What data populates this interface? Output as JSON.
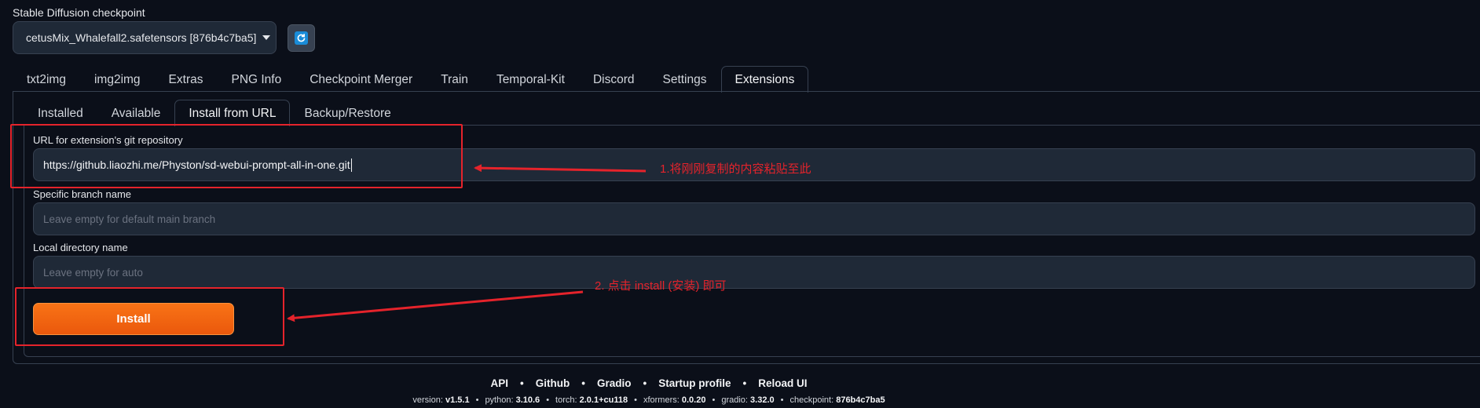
{
  "checkpoint": {
    "label": "Stable Diffusion checkpoint",
    "selected": "cetusMix_Whalefall2.safetensors [876b4c7ba5]",
    "refresh_icon": "refresh-icon"
  },
  "main_tabs": [
    "txt2img",
    "img2img",
    "Extras",
    "PNG Info",
    "Checkpoint Merger",
    "Train",
    "Temporal-Kit",
    "Discord",
    "Settings",
    "Extensions"
  ],
  "main_tab_active": "Extensions",
  "sub_tabs": [
    "Installed",
    "Available",
    "Install from URL",
    "Backup/Restore"
  ],
  "sub_tab_active": "Install from URL",
  "form": {
    "url_label": "URL for extension's git repository",
    "url_value": "https://github.liaozhi.me/Physton/sd-webui-prompt-all-in-one.git",
    "branch_label": "Specific branch name",
    "branch_placeholder": "Leave empty for default main branch",
    "dir_label": "Local directory name",
    "dir_placeholder": "Leave empty for auto",
    "install_label": "Install"
  },
  "annotations": {
    "step1": "1.将刚刚复制的内容粘贴至此",
    "step2": "2. 点击 install (安装) 即可",
    "color": "#e5232b"
  },
  "footer": {
    "links": [
      "API",
      "Github",
      "Gradio",
      "Startup profile",
      "Reload UI"
    ],
    "version": [
      {
        "key": "version:",
        "val": "v1.5.1"
      },
      {
        "key": "python:",
        "val": "3.10.6"
      },
      {
        "key": "torch:",
        "val": "2.0.1+cu118"
      },
      {
        "key": "xformers:",
        "val": "0.0.20"
      },
      {
        "key": "gradio:",
        "val": "3.32.0"
      },
      {
        "key": "checkpoint:",
        "val": "876b4c7ba5"
      }
    ]
  },
  "colors": {
    "accent": "#f97316",
    "background": "#0b0f19",
    "input_bg": "#1f2937"
  }
}
